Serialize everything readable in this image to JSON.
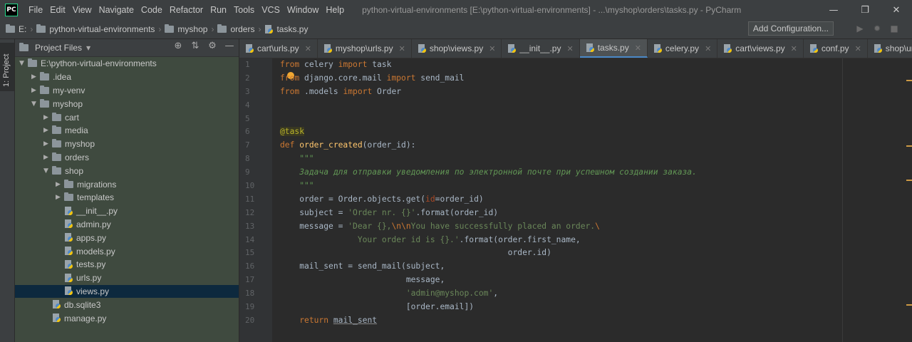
{
  "app": {
    "logo": "PC",
    "title": "python-virtual-environments [E:\\python-virtual-environments] - ...\\myshop\\orders\\tasks.py - PyCharm"
  },
  "menu": [
    "File",
    "Edit",
    "View",
    "Navigate",
    "Code",
    "Refactor",
    "Run",
    "Tools",
    "VCS",
    "Window",
    "Help"
  ],
  "window_controls": {
    "minimize": "—",
    "maximize": "❐",
    "close": "✕"
  },
  "breadcrumb": [
    "E:",
    "python-virtual-environments",
    "myshop",
    "orders",
    "tasks.py"
  ],
  "toolbar": {
    "add_configuration": "Add Configuration...",
    "run_icon": "▶",
    "debug_icon": "✹",
    "stop_icon": "■"
  },
  "tool_window": {
    "stripe_label": "1: Project",
    "header": "Project Files",
    "dropdown_icon": "▼",
    "tools": [
      "⊕",
      "⇅",
      "⚙",
      "—"
    ]
  },
  "tree": [
    {
      "label": "E:\\python-virtual-environments",
      "type": "folder",
      "depth": 0,
      "expanded": true
    },
    {
      "label": ".idea",
      "type": "folder",
      "depth": 1,
      "expanded": false
    },
    {
      "label": "my-venv",
      "type": "folder",
      "depth": 1,
      "expanded": false
    },
    {
      "label": "myshop",
      "type": "folder",
      "depth": 1,
      "expanded": true
    },
    {
      "label": "cart",
      "type": "folder",
      "depth": 2,
      "expanded": false
    },
    {
      "label": "media",
      "type": "folder",
      "depth": 2,
      "expanded": false
    },
    {
      "label": "myshop",
      "type": "folder",
      "depth": 2,
      "expanded": false
    },
    {
      "label": "orders",
      "type": "folder",
      "depth": 2,
      "expanded": false
    },
    {
      "label": "shop",
      "type": "folder",
      "depth": 2,
      "expanded": true
    },
    {
      "label": "migrations",
      "type": "folder",
      "depth": 3,
      "expanded": false
    },
    {
      "label": "templates",
      "type": "folder",
      "depth": 3,
      "expanded": false
    },
    {
      "label": "__init__.py",
      "type": "py",
      "depth": 3
    },
    {
      "label": "admin.py",
      "type": "py",
      "depth": 3
    },
    {
      "label": "apps.py",
      "type": "py",
      "depth": 3
    },
    {
      "label": "models.py",
      "type": "py",
      "depth": 3
    },
    {
      "label": "tests.py",
      "type": "py",
      "depth": 3
    },
    {
      "label": "urls.py",
      "type": "py",
      "depth": 3
    },
    {
      "label": "views.py",
      "type": "py",
      "depth": 3,
      "selected": true
    },
    {
      "label": "db.sqlite3",
      "type": "file",
      "depth": 2
    },
    {
      "label": "manage.py",
      "type": "py",
      "depth": 2
    }
  ],
  "tabs": [
    {
      "label": "cart\\urls.py"
    },
    {
      "label": "myshop\\urls.py"
    },
    {
      "label": "shop\\views.py"
    },
    {
      "label": "__init__.py"
    },
    {
      "label": "tasks.py",
      "active": true
    },
    {
      "label": "celery.py"
    },
    {
      "label": "cart\\views.py"
    },
    {
      "label": "conf.py"
    },
    {
      "label": "shop\\urls.py"
    }
  ],
  "tab_close": "✕",
  "line_numbers": [
    "1",
    "2",
    "3",
    "4",
    "5",
    "6",
    "7",
    "8",
    "9",
    "10",
    "11",
    "12",
    "13",
    "14",
    "15",
    "16",
    "17",
    "18",
    "19",
    "20"
  ],
  "code": [
    [
      [
        "kw",
        "from"
      ],
      [
        "p",
        " celery "
      ],
      [
        "kw",
        "import"
      ],
      [
        "p",
        " task"
      ]
    ],
    [
      [
        "kw",
        "from"
      ],
      [
        "p",
        " django.core.mail "
      ],
      [
        "kw",
        "import"
      ],
      [
        "p",
        " send_mail"
      ]
    ],
    [
      [
        "kw",
        "from"
      ],
      [
        "p",
        " .models "
      ],
      [
        "kw",
        "import"
      ],
      [
        "p",
        " Order"
      ]
    ],
    [],
    [],
    [
      [
        "deco",
        "@task"
      ]
    ],
    [
      [
        "kw",
        "def"
      ],
      [
        "p",
        " "
      ],
      [
        "fn",
        "order_created"
      ],
      [
        "p",
        "(order_id):"
      ]
    ],
    [
      [
        "doc",
        "    \"\"\""
      ]
    ],
    [
      [
        "doc",
        "    Задача для отправки уведомления по электронной почте при успешном создании заказа."
      ]
    ],
    [
      [
        "doc",
        "    \"\"\""
      ]
    ],
    [
      [
        "p",
        "    order = Order.objects.get("
      ],
      [
        "param",
        "id"
      ],
      [
        "p",
        "=order_id)"
      ]
    ],
    [
      [
        "p",
        "    subject = "
      ],
      [
        "str",
        "'Order nr. {}'"
      ],
      [
        "p",
        ".format(order_id)"
      ]
    ],
    [
      [
        "p",
        "    message = "
      ],
      [
        "str",
        "'Dear {},"
      ],
      [
        "esc",
        "\\n\\n"
      ],
      [
        "str",
        "You have successfully placed an order."
      ],
      [
        "esc",
        "\\"
      ]
    ],
    [
      [
        "str",
        "                Your order id is {}.'"
      ],
      [
        "p",
        ".format(order.first_name,"
      ]
    ],
    [
      [
        "p",
        "                                               order.id)"
      ]
    ],
    [
      [
        "p",
        "    mail_sent = send_mail(subject,"
      ]
    ],
    [
      [
        "p",
        "                          message,"
      ]
    ],
    [
      [
        "p",
        "                          "
      ],
      [
        "str",
        "'admin@myshop.com'"
      ],
      [
        "p",
        ","
      ]
    ],
    [
      [
        "p",
        "                          [order.email])"
      ]
    ],
    [
      [
        "p",
        "    "
      ],
      [
        "kw",
        "return"
      ],
      [
        "p",
        " "
      ],
      [
        "ul",
        "mail_sent"
      ]
    ]
  ],
  "colors": {
    "keyword": "#cc7832",
    "function": "#ffc66d",
    "string": "#6a8759",
    "docstring": "#629755",
    "decorator": "#bbb529",
    "text": "#a9b7c6",
    "accent": "#4a88c7"
  }
}
